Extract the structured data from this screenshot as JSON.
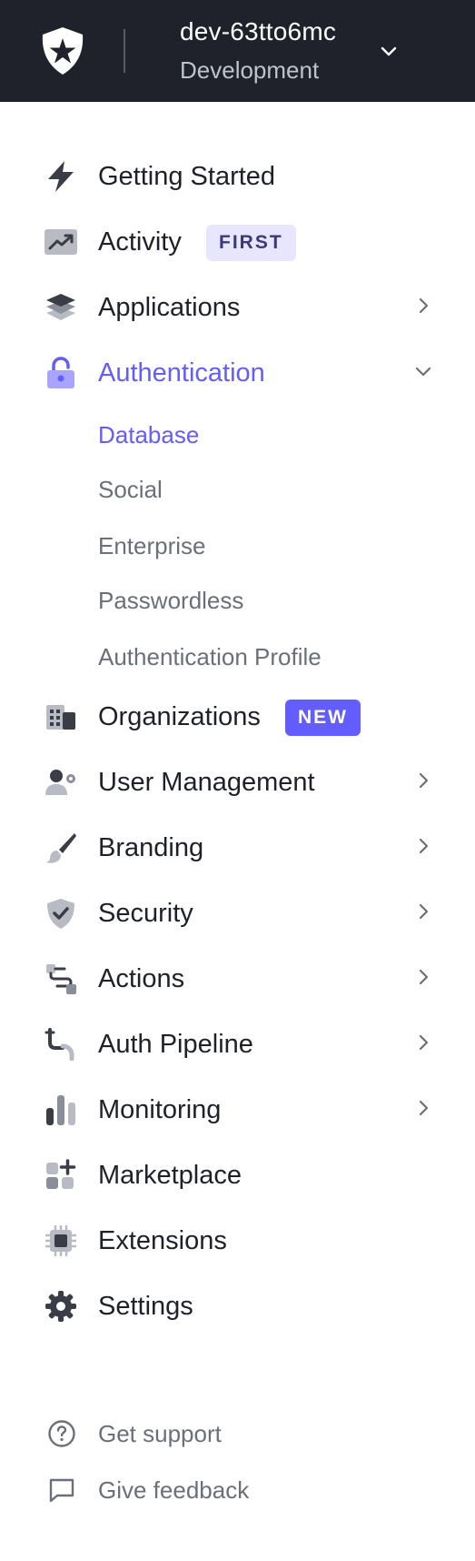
{
  "header": {
    "logo_icon": "auth0-shield-logo",
    "tenant_name": "dev-63tto6mc",
    "tenant_env": "Development",
    "chevron_icon": "chevron-down-icon"
  },
  "colors": {
    "header_bg": "#1f222a",
    "accent": "#635dff",
    "badge_first_bg": "#e8e6ff",
    "text_primary": "#1e212a",
    "text_secondary": "#6a6f7a"
  },
  "nav": {
    "items": [
      {
        "label": "Getting Started",
        "icon": "bolt-icon"
      },
      {
        "label": "Activity",
        "icon": "trending-chart-icon",
        "badge": "FIRST"
      },
      {
        "label": "Applications",
        "icon": "layers-icon",
        "has_chevron": true
      },
      {
        "label": "Authentication",
        "icon": "lock-icon",
        "active": true,
        "expanded": true
      },
      {
        "label": "Organizations",
        "icon": "buildings-icon",
        "badge": "NEW"
      },
      {
        "label": "User Management",
        "icon": "user-gear-icon",
        "has_chevron": true
      },
      {
        "label": "Branding",
        "icon": "paintbrush-icon",
        "has_chevron": true
      },
      {
        "label": "Security",
        "icon": "shield-check-icon",
        "has_chevron": true
      },
      {
        "label": "Actions",
        "icon": "flow-icon",
        "has_chevron": true
      },
      {
        "label": "Auth Pipeline",
        "icon": "pipe-icon",
        "has_chevron": true
      },
      {
        "label": "Monitoring",
        "icon": "bar-chart-icon",
        "has_chevron": true
      },
      {
        "label": "Marketplace",
        "icon": "grid-plus-icon"
      },
      {
        "label": "Extensions",
        "icon": "chip-icon"
      },
      {
        "label": "Settings",
        "icon": "gear-icon"
      }
    ],
    "auth_subitems": [
      {
        "label": "Database",
        "active": true
      },
      {
        "label": "Social"
      },
      {
        "label": "Enterprise"
      },
      {
        "label": "Passwordless"
      },
      {
        "label": "Authentication Profile"
      }
    ]
  },
  "footer": {
    "support_label": "Get support",
    "support_icon": "question-circle-icon",
    "feedback_label": "Give feedback",
    "feedback_icon": "chat-bubble-icon"
  }
}
